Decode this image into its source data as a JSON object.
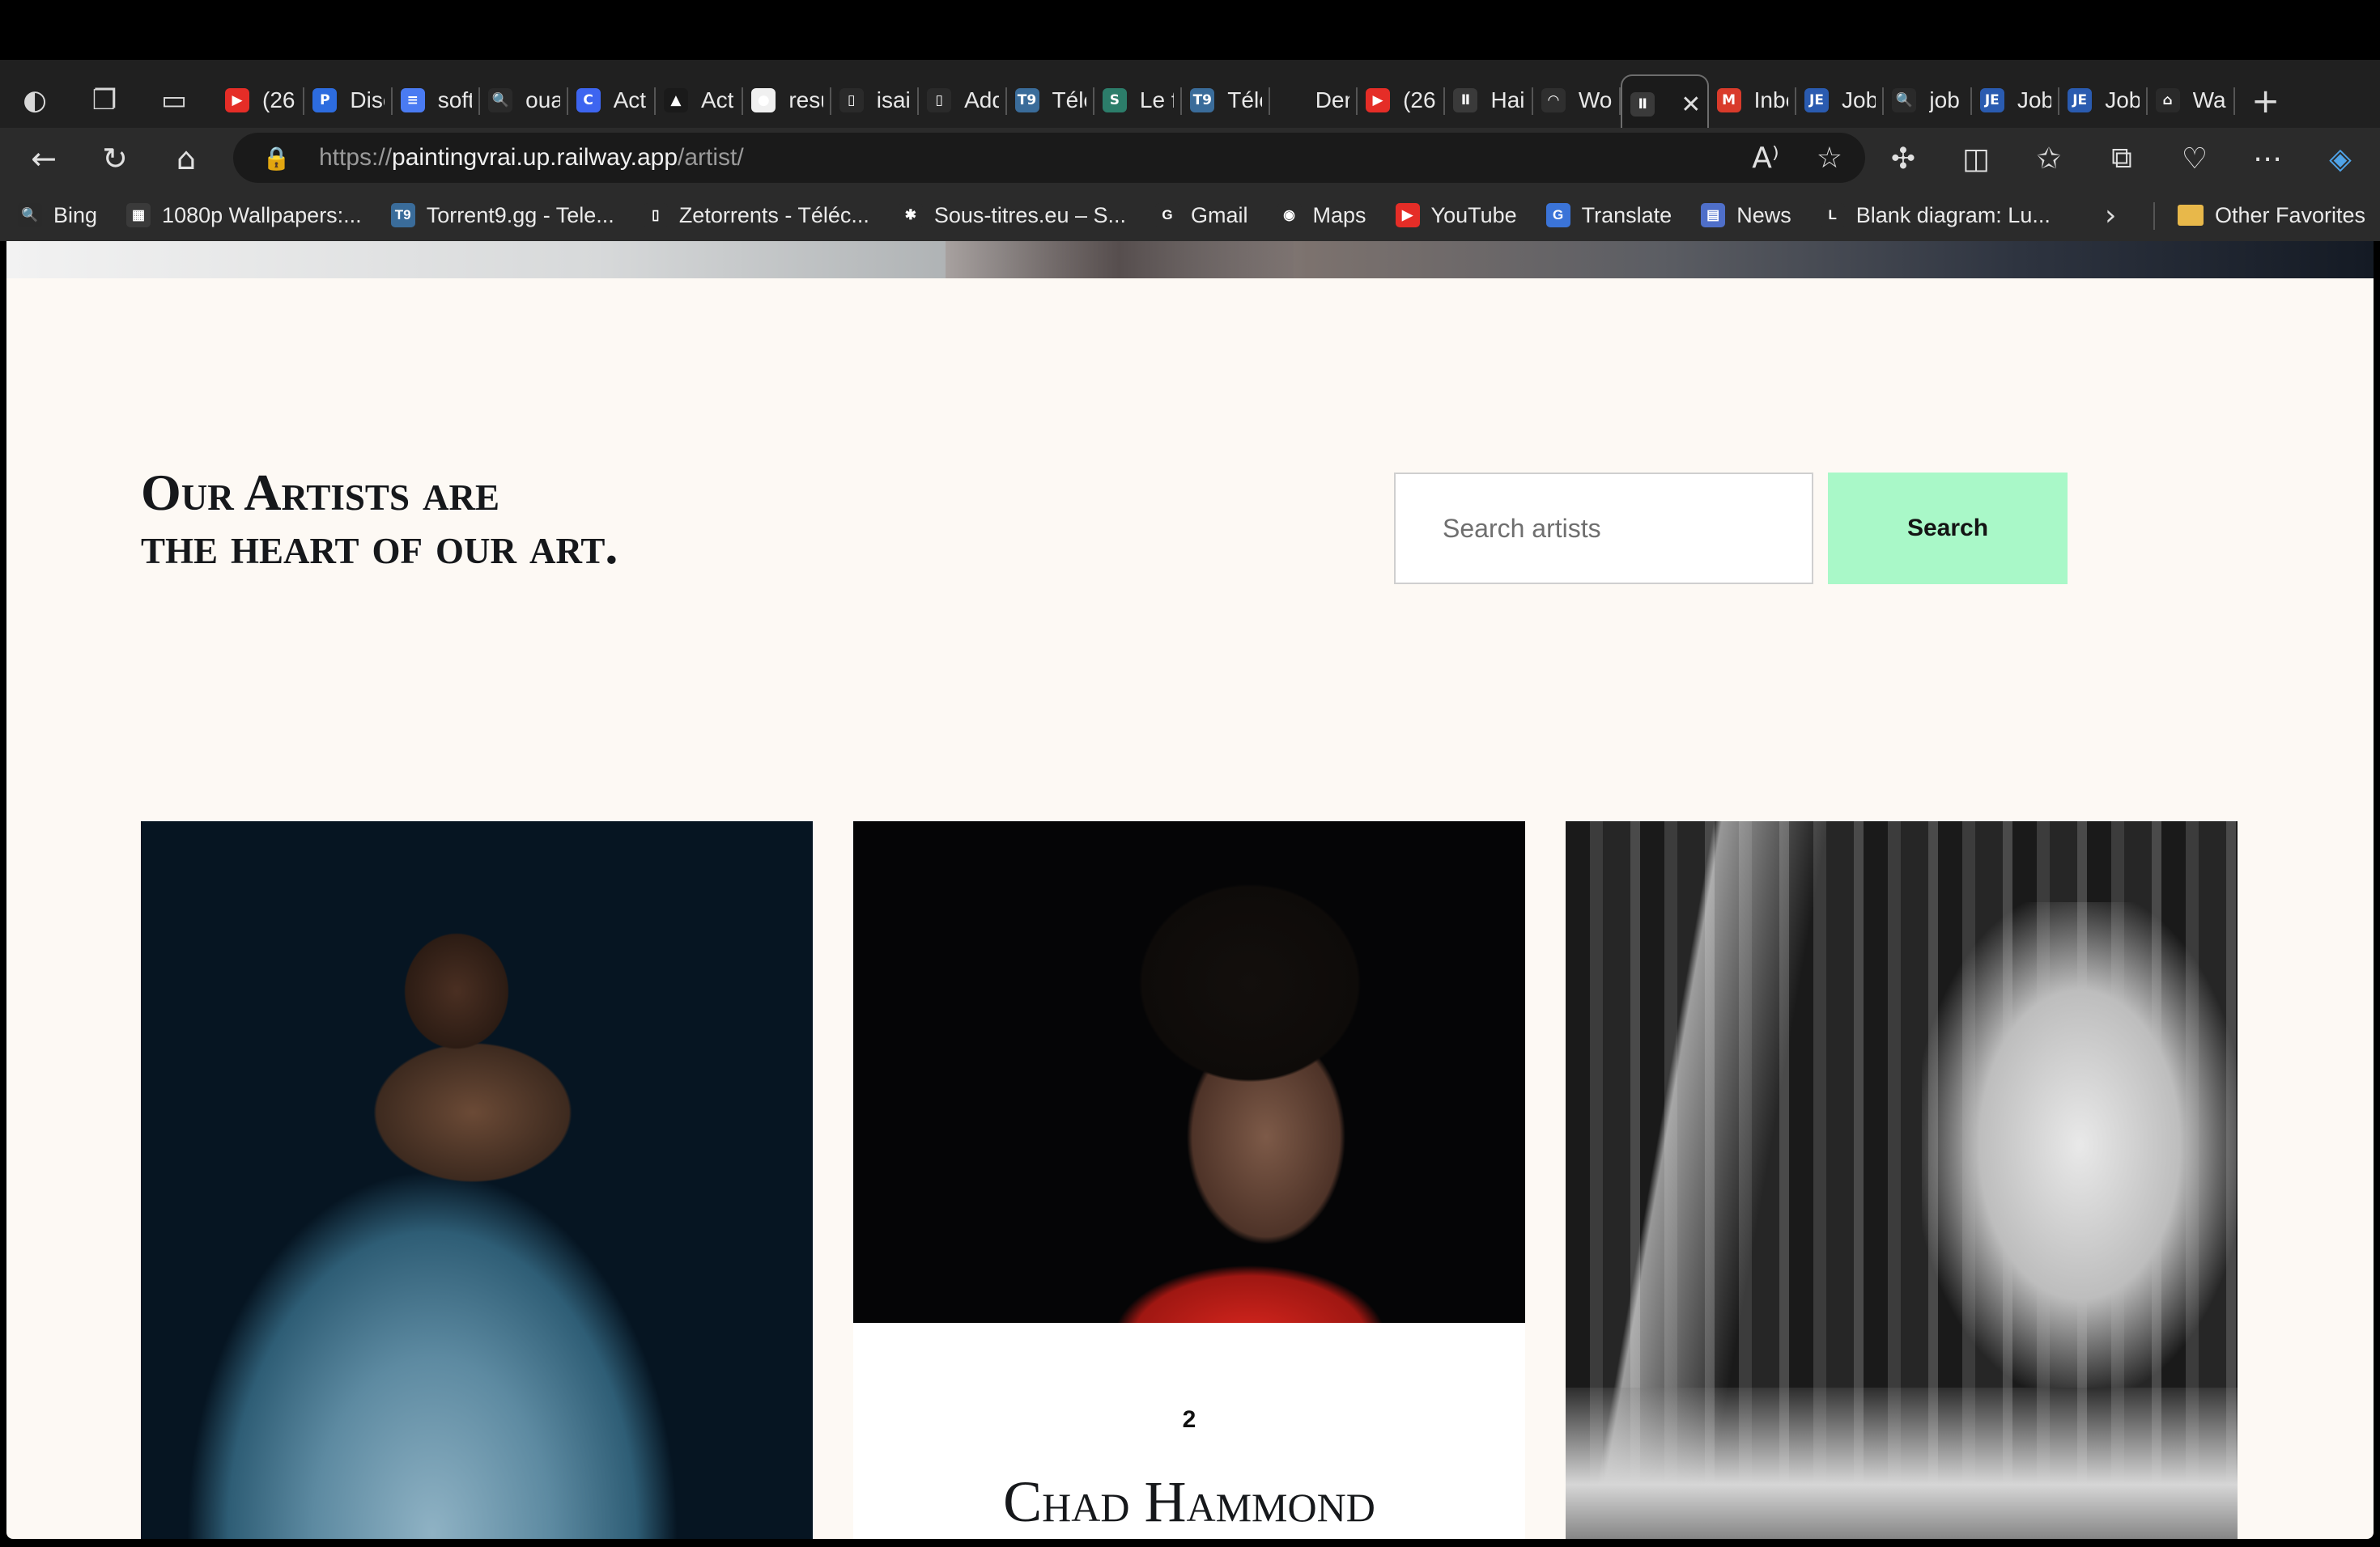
{
  "browser": {
    "tabs": [
      {
        "title": "(26",
        "icon": "youtube-icon",
        "color": "#e52d27"
      },
      {
        "title": "Disc",
        "icon": "p-icon",
        "color": "#2d6cdf"
      },
      {
        "title": "soft",
        "icon": "docs-icon",
        "color": "#4a7bf2"
      },
      {
        "title": "oua",
        "icon": "search-icon",
        "color": "#2a2a2a"
      },
      {
        "title": "Act",
        "icon": "c-icon",
        "color": "#3d65f0"
      },
      {
        "title": "Act",
        "icon": "drive-icon",
        "color": "#1a1a1a"
      },
      {
        "title": "resu",
        "icon": "record-icon",
        "color": "#f0f0f0"
      },
      {
        "title": "isai",
        "icon": "page-icon",
        "color": "#2a2a2a"
      },
      {
        "title": "Add",
        "icon": "page-icon",
        "color": "#2a2a2a"
      },
      {
        "title": "Télé",
        "icon": "t9-icon",
        "color": "#3a6c9a"
      },
      {
        "title": "Le f",
        "icon": "s-icon",
        "color": "#2c7d6a"
      },
      {
        "title": "Télé",
        "icon": "t9-icon",
        "color": "#3a6c9a"
      },
      {
        "title": "Der",
        "icon": "blank-icon",
        "color": "#202020"
      },
      {
        "title": "(26",
        "icon": "youtube-icon",
        "color": "#e52d27"
      },
      {
        "title": "Hai",
        "icon": "brand-icon",
        "color": "#3a3a3a"
      },
      {
        "title": "Wo",
        "icon": "audio-icon",
        "color": "#2f2f2f"
      },
      {
        "title": "",
        "icon": "brand-icon",
        "color": "#3a3a3a",
        "active": true
      },
      {
        "title": "Inbo",
        "icon": "gmail-icon",
        "color": "#d93b2b"
      },
      {
        "title": "Job",
        "icon": "je-icon",
        "color": "#2a5bb0"
      },
      {
        "title": "job",
        "icon": "search-icon",
        "color": "#2a2a2a"
      },
      {
        "title": "Job",
        "icon": "je-icon",
        "color": "#2a5bb0"
      },
      {
        "title": "Job",
        "icon": "je-icon",
        "color": "#2a5bb0"
      },
      {
        "title": "Wal",
        "icon": "bag-icon",
        "color": "#2a2a2a"
      }
    ],
    "tab_glyphs": {
      "youtube-icon": "▶",
      "p-icon": "P",
      "docs-icon": "≡",
      "search-icon": "🔍",
      "c-icon": "C",
      "drive-icon": "▲",
      "record-icon": "●",
      "page-icon": "▯",
      "t9-icon": "T9",
      "s-icon": "S",
      "blank-icon": "",
      "brand-icon": "Ⅱ",
      "audio-icon": "◠",
      "gmail-icon": "M",
      "je-icon": "JE",
      "bag-icon": "⌂"
    },
    "url": {
      "prefix": "https://",
      "host": "paintingvrai.up.railway.app",
      "path": "/artist/"
    },
    "bookmarks": [
      {
        "label": "Bing",
        "icon": "search-icon",
        "color": "#2a2a2a",
        "glyph": "🔍"
      },
      {
        "label": "1080p Wallpapers:...",
        "icon": "wallpaper-icon",
        "color": "#3a3a3a",
        "glyph": "▦"
      },
      {
        "label": "Torrent9.gg - Tele...",
        "icon": "t9-icon",
        "color": "#3a6c9a",
        "glyph": "T9"
      },
      {
        "label": "Zetorrents - Téléc...",
        "icon": "page-icon",
        "color": "#2b2b2b",
        "glyph": "▯"
      },
      {
        "label": "Sous-titres.eu – S...",
        "icon": "star-icon",
        "color": "#2b2b2b",
        "glyph": "✱"
      },
      {
        "label": "Gmail",
        "icon": "google-icon",
        "color": "#2b2b2b",
        "glyph": "G"
      },
      {
        "label": "Maps",
        "icon": "maps-icon",
        "color": "#2b2b2b",
        "glyph": "◉"
      },
      {
        "label": "YouTube",
        "icon": "youtube-icon",
        "color": "#e52d27",
        "glyph": "▶"
      },
      {
        "label": "Translate",
        "icon": "translate-icon",
        "color": "#3b74d8",
        "glyph": "G"
      },
      {
        "label": "News",
        "icon": "news-icon",
        "color": "#4f6fc9",
        "glyph": "▤"
      },
      {
        "label": "Blank diagram: Lu...",
        "icon": "lucid-icon",
        "color": "#2b2b2b",
        "glyph": "L"
      }
    ],
    "other_favorites": "Other Favorites"
  },
  "page": {
    "headline_line1": "Our Artists are",
    "headline_line2": "the heart of our art.",
    "search_placeholder": "Search artists",
    "search_button": "Search"
  },
  "artists": [
    {
      "number": "",
      "name": ""
    },
    {
      "number": "2",
      "name": "Chad Hammond"
    },
    {
      "number": "",
      "name": ""
    }
  ]
}
